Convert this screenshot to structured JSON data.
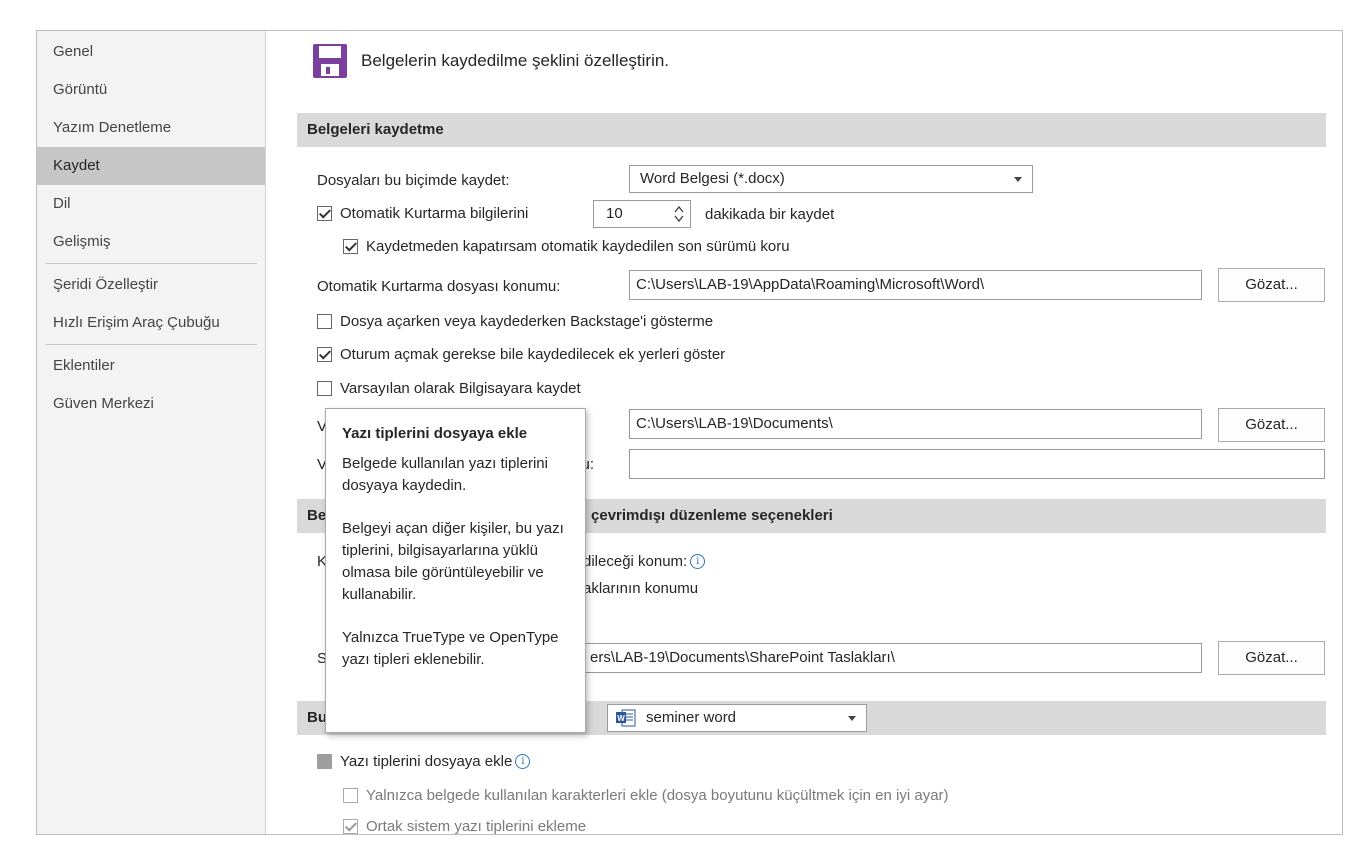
{
  "sidebar": {
    "items": [
      {
        "label": "Genel"
      },
      {
        "label": "Görüntü"
      },
      {
        "label": "Yazım Denetleme"
      },
      {
        "label": "Kaydet"
      },
      {
        "label": "Dil"
      },
      {
        "label": "Gelişmiş"
      },
      {
        "label": "Şeridi Özelleştir"
      },
      {
        "label": "Hızlı Erişim Araç Çubuğu"
      },
      {
        "label": "Eklentiler"
      },
      {
        "label": "Güven Merkezi"
      }
    ],
    "selected": "Kaydet"
  },
  "header": {
    "title": "Belgelerin kaydedilme şeklini özelleştirin."
  },
  "save_section": {
    "title": "Belgeleri kaydetme",
    "format_label": "Dosyaları bu biçimde kaydet:",
    "format_value": "Word Belgesi (*.docx)",
    "autorecover_label": "Otomatik Kurtarma bilgilerini",
    "autorecover_minutes": "10",
    "autorecover_suffix": "dakikada bir kaydet",
    "keep_last_label": "Kaydetmeden kapatırsam otomatik kaydedilen son sürümü koru",
    "autorecover_location_label": "Otomatik Kurtarma dosyası konumu:",
    "autorecover_location_value": "C:\\Users\\LAB-19\\AppData\\Roaming\\Microsoft\\Word\\",
    "browse_label": "Gözat...",
    "backstage_label": "Dosya açarken veya kaydederken Backstage'i gösterme",
    "additional_places_label": "Oturum açmak gerekse bile kaydedilecek ek yerleri göster",
    "save_computer_label": "Varsayılan olarak Bilgisayara kaydet",
    "default_location_label_start": "V",
    "default_location_value": "C:\\Users\\LAB-19\\Documents\\",
    "templates_label_start": "V",
    "templates_label_end": "mu:",
    "templates_value": ""
  },
  "offline_section": {
    "title_start": "Be",
    "title_end": "için çevrimdışı düzenleme seçenekleri",
    "location_label_start": "K",
    "location_label_end": "dileceği konum:",
    "drafts_label_end": "aklarının konumu",
    "server_label_start": "S",
    "server_value": "ers\\LAB-19\\Documents\\SharePoint Taslakları\\",
    "browse_label": "Gözat..."
  },
  "fidelity_section": {
    "title_start": "Bu",
    "document_value": "seminer word",
    "embed_fonts_label": "Yazı tiplerini dosyaya ekle",
    "embed_used_chars_label": "Yalnızca belgede kullanılan karakterleri ekle (dosya boyutunu küçültmek için en iyi ayar)",
    "no_common_fonts_label": "Ortak sistem yazı tiplerini ekleme"
  },
  "tooltip": {
    "title": "Yazı tiplerini dosyaya ekle",
    "para1": "Belgede kullanılan yazı tiplerini dosyaya kaydedin.",
    "para2": "Belgeyi açan diğer kişiler, bu yazı tiplerini, bilgisayarlarına yüklü olmasa bile görüntüleyebilir ve kullanabilir.",
    "para3": "Yalnızca TrueType ve OpenType yazı tipleri eklenebilir."
  },
  "colors": {
    "section_bg": "#d9d9d9",
    "sidebar_bg": "#f3f3f3",
    "selected_bg": "#c6c6c6",
    "floppy_purple": "#7b3fa0",
    "info_blue": "#2e75b6"
  },
  "icons": {
    "header": "floppy-disk-icon",
    "document": "word-document-icon",
    "info": "info-icon"
  }
}
